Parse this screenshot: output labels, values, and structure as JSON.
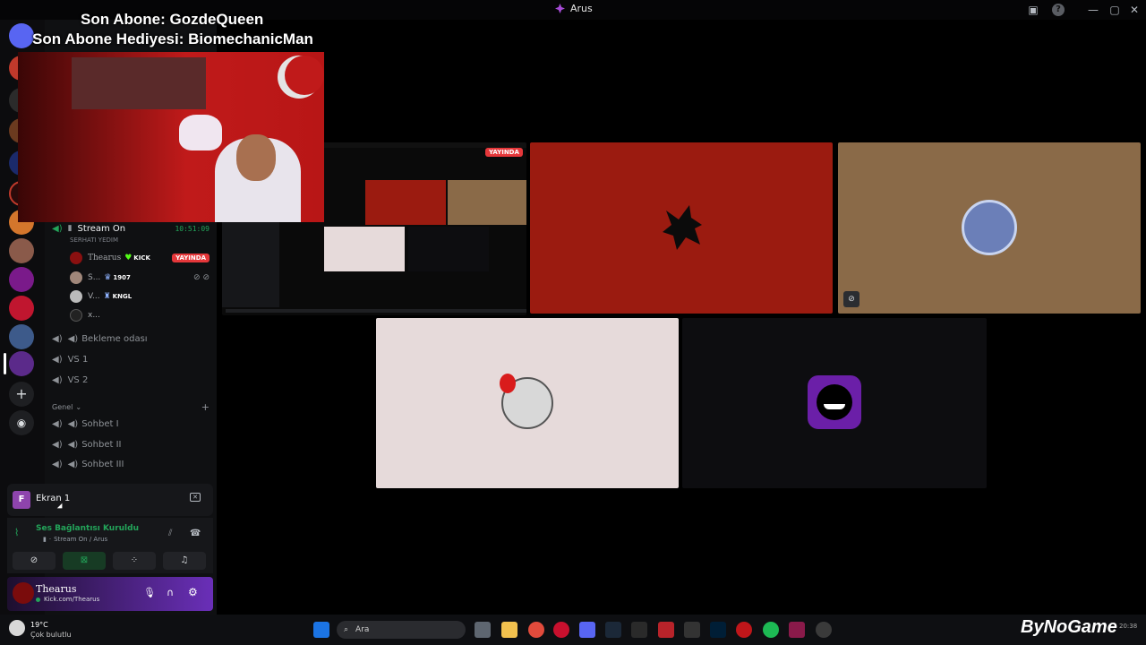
{
  "window": {
    "title": "Arus"
  },
  "overlay": {
    "sub_line": "Son Abone: GozdeQueen",
    "gift_line": "Son Abone Hediyesi: BiomechanicMan"
  },
  "channel": {
    "name": "Stream On",
    "duration": "10:51:09",
    "subtitle": "SERHATI YEDIM",
    "users": [
      {
        "name": "Thearus",
        "badge": "KICK",
        "live": "YAYINDA"
      },
      {
        "name": "S...",
        "badge": "1907"
      },
      {
        "name": "V...",
        "badge": "KNGL"
      },
      {
        "name": "x..."
      }
    ]
  },
  "voice_channels": [
    "Bekleme odası",
    "VS 1",
    "VS 2"
  ],
  "category": {
    "name": "Genel",
    "channels": [
      "Sohbet I",
      "Sohbet II",
      "Sohbet III"
    ]
  },
  "screen_panel": {
    "label": "Ekran 1",
    "avatar_letter": "F"
  },
  "voice_status": {
    "title": "Ses Bağlantısı Kuruldu",
    "detail": "Stream On / Arus"
  },
  "user_panel": {
    "name": "Thearus",
    "status": "Kick.com/Thearus"
  },
  "stream": {
    "live_badge": "YAYINDA"
  },
  "taskbar": {
    "weather_temp": "19°C",
    "weather_desc": "Çok bulutlu",
    "search_placeholder": "Ara",
    "clock_time": "20:38",
    "watermark": "ByNoGame"
  },
  "colors": {
    "accent": "#5865f2",
    "live_red": "#e5373a",
    "connected_green": "#23a55a",
    "user_panel_purple": "#6a2fb8"
  }
}
